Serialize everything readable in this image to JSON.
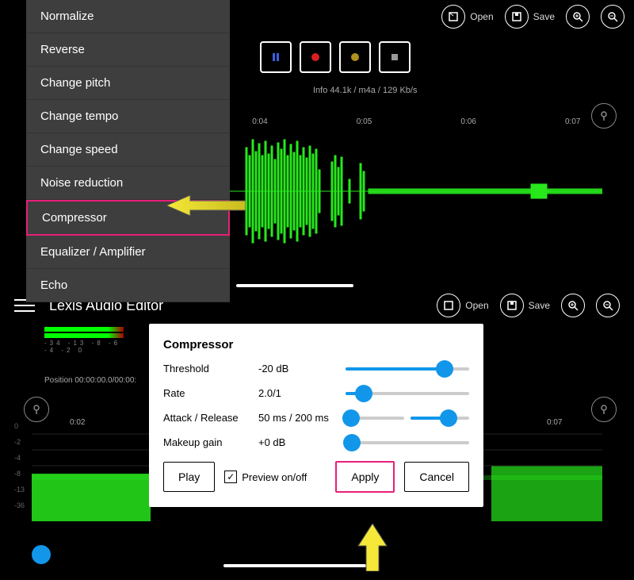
{
  "topToolbar": {
    "open": "Open",
    "save": "Save"
  },
  "menu": {
    "items": [
      "Normalize",
      "Reverse",
      "Change pitch",
      "Change tempo",
      "Change speed",
      "Noise reduction",
      "Compressor",
      "Equalizer / Amplifier",
      "Echo"
    ],
    "highlighted_index": 6
  },
  "info": "Info  44.1k / m4a / 129 Kb/s",
  "timeline_top": [
    "0:04",
    "0:05",
    "0:06",
    "0:07"
  ],
  "app_title": "Lexis Audio Editor",
  "meter_ticks": "-34 -13 -8 -6 -4 -2 0",
  "position_line": "Position  00:00:00.0/00:00:",
  "timeline_bottom": [
    "0:02",
    "0:07"
  ],
  "scale_db": [
    "0",
    "-2",
    "-4",
    "-8",
    "-13",
    "-36"
  ],
  "dialog": {
    "title": "Compressor",
    "rows": {
      "threshold": {
        "label": "Threshold",
        "value": "-20 dB",
        "thumb": 80,
        "fill": 80
      },
      "rate": {
        "label": "Rate",
        "value": "2.0/1",
        "thumb": 15,
        "fill": 15
      },
      "attack": {
        "label": "Attack / Release",
        "value": "50 ms  /  200 ms",
        "thumbA": 10,
        "thumbB": 65
      },
      "makeup": {
        "label": "Makeup gain",
        "value": "+0 dB",
        "thumb": 5,
        "fill": 5
      }
    },
    "play": "Play",
    "preview": "Preview on/off",
    "apply": "Apply",
    "cancel": "Cancel"
  }
}
